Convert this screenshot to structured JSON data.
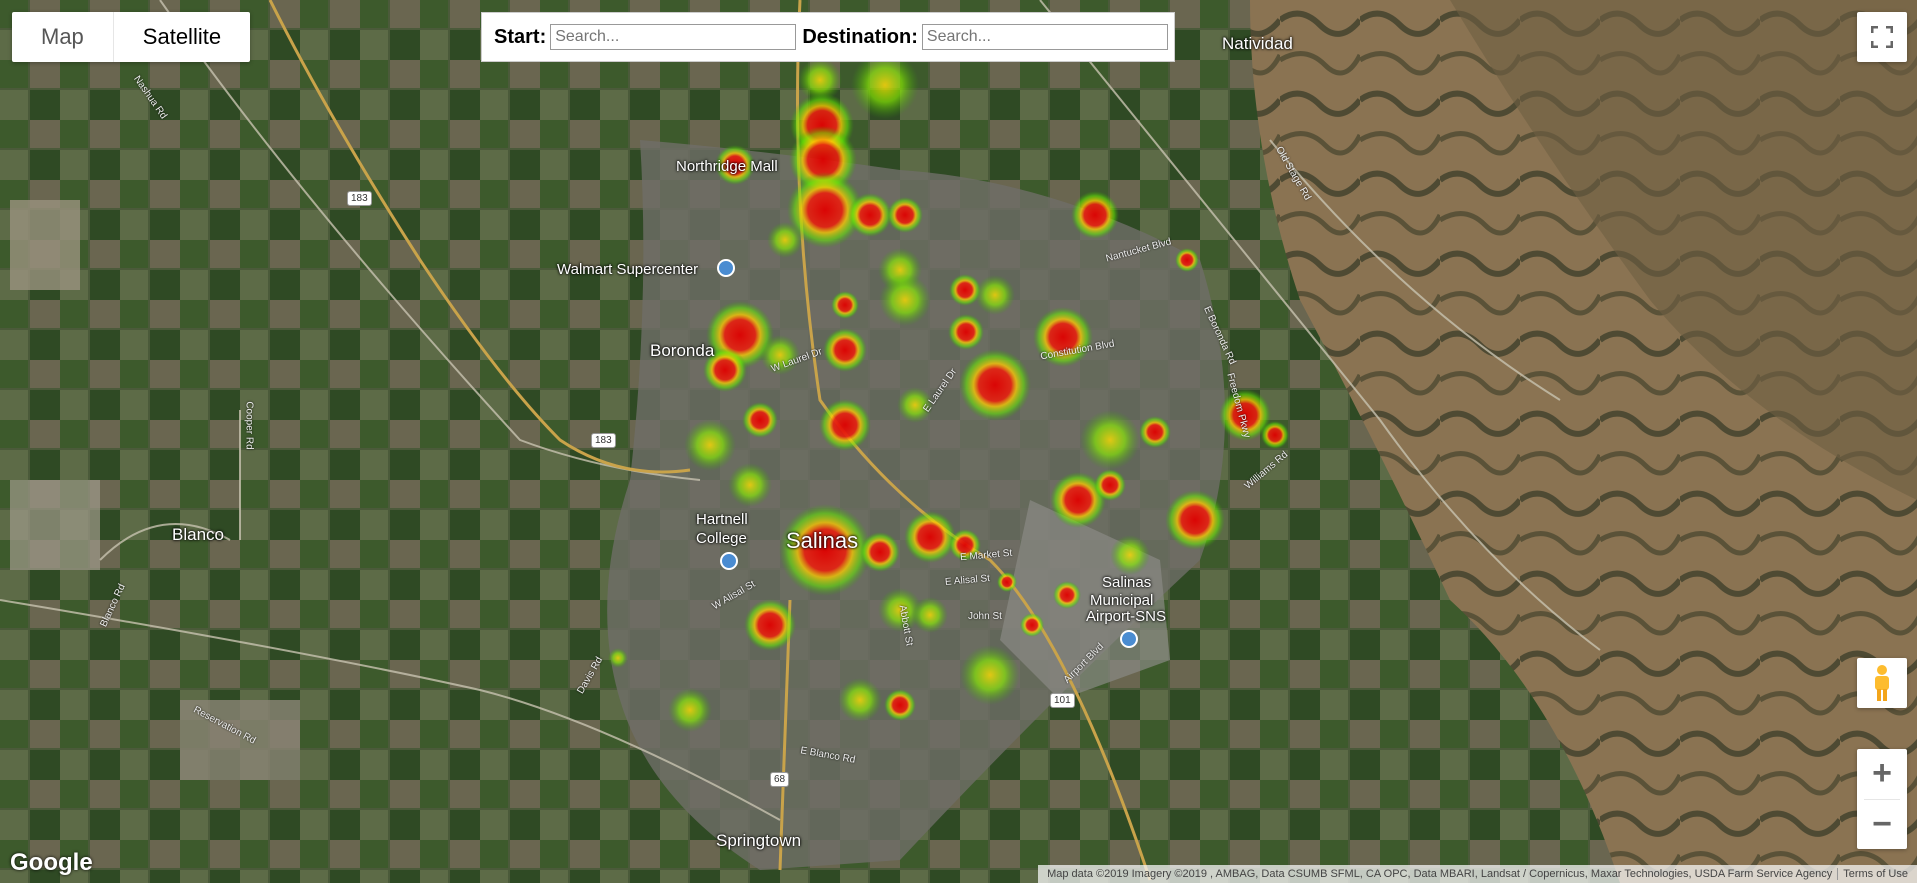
{
  "map_type": {
    "options": [
      "Map",
      "Satellite"
    ],
    "selected": "Satellite"
  },
  "route": {
    "start_label": "Start:",
    "start_placeholder": "Search...",
    "destination_label": "Destination:",
    "destination_placeholder": "Search..."
  },
  "places": [
    {
      "name": "Natividad",
      "class": "city"
    },
    {
      "name": "Northridge Mall",
      "class": ""
    },
    {
      "name": "Walmart Supercenter",
      "class": ""
    },
    {
      "name": "Boronda",
      "class": "city"
    },
    {
      "name": "Hartnell",
      "class": ""
    },
    {
      "name": "College",
      "class": ""
    },
    {
      "name": "Salinas",
      "class": "big"
    },
    {
      "name": "Blanco",
      "class": "city"
    },
    {
      "name": "Salinas",
      "class": ""
    },
    {
      "name": "Municipal",
      "class": ""
    },
    {
      "name": "Airport-SNS",
      "class": ""
    },
    {
      "name": "Springtown",
      "class": "city"
    }
  ],
  "roads": [
    "Nashua Rd",
    "Old Stage Rd",
    "Cooper Rd",
    "E Boronda Rd",
    "Nantucket Blvd",
    "Constitution Blvd",
    "Freedom Pkwy",
    "Williams Rd",
    "E Laurel Dr",
    "W Laurel Dr",
    "W Alisal St",
    "E Alisal St",
    "John St",
    "E Market St",
    "Blanco Rd",
    "E Blanco Rd",
    "Reservation Rd",
    "Davis Rd",
    "Airport Blvd",
    "Abbott St"
  ],
  "route_shields": [
    "183",
    "183",
    "101",
    "68"
  ],
  "logo": "Google",
  "attribution": {
    "data": "Map data ©2019 Imagery ©2019 , AMBAG, Data CSUMB SFML, CA OPC, Data MBARI, Landsat / Copernicus, Maxar Technologies, USDA Farm Service Agency",
    "terms": "Terms of Use"
  },
  "controls": {
    "fullscreen": "fullscreen-icon",
    "pegman": "pegman-icon",
    "zoom_in": "+",
    "zoom_out": "−"
  },
  "colors": {
    "hot": "#d40000",
    "mid": "#ffcc00",
    "cool": "#66dd00"
  }
}
